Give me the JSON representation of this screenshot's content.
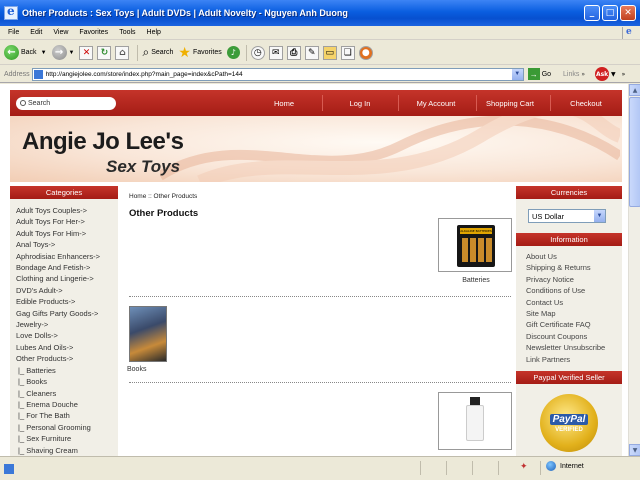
{
  "window": {
    "title": "Other Products : Sex Toys | Adult DVDs | Adult Novelty - Nguyen Anh Duong"
  },
  "menu": [
    "File",
    "Edit",
    "View",
    "Favorites",
    "Tools",
    "Help"
  ],
  "toolbar": {
    "back_label": "Back",
    "search_label": "Search",
    "favorites_label": "Favorites"
  },
  "address": {
    "label": "Address",
    "url": "http://angiejolee.com/store/index.php?main_page=index&cPath=144",
    "go_label": "Go",
    "links_label": "Links"
  },
  "site": {
    "search_placeholder": "Search",
    "nav": [
      "Home",
      "Log In",
      "My Account",
      "Shopping Cart",
      "Checkout"
    ],
    "logo_main": "Angie Jo Lee's",
    "logo_sub": "Sex Toys",
    "categories_title": "Categories",
    "categories": [
      "Adult Toys Couples->",
      "Adult Toys For Her->",
      "Adult Toys For Him->",
      "Anal Toys->",
      "Aphrodisiac Enhancers->",
      "Bondage And Fetish->",
      "Clothing and Lingerie->",
      "DVD's Adult->",
      "Edible Products->",
      "Gag Gifts Party Goods->",
      "Jewelry->",
      "Love Dolls->",
      "Lubes And Oils->",
      "Other Products->"
    ],
    "subcategories": [
      "|_ Batteries",
      "|_ Books",
      "|_ Cleaners",
      "|_ Enema Douche",
      "|_ For The Bath",
      "|_ Personal Grooming",
      "|_ Sex Furniture",
      "|_ Shaving Cream"
    ],
    "breadcrumb": "Home :: Other Products",
    "page_title": "Other Products",
    "products": [
      "Batteries",
      "Books"
    ],
    "battery_pack_text": "ALKALINE BATTERIES",
    "currencies_title": "Currencies",
    "currency_selected": "US Dollar",
    "information_title": "Information",
    "information": [
      "About Us",
      "Shipping & Returns",
      "Privacy Notice",
      "Conditions of Use",
      "Contact Us",
      "Site Map",
      "Gift Certificate FAQ",
      "Discount Coupons",
      "Newsletter Unsubscribe",
      "Link Partners"
    ],
    "paypal_title": "Paypal Verified Seller",
    "paypal_badge_text": "PayPal",
    "paypal_badge_sub": "VERIFIED"
  },
  "status": {
    "zone_label": "Internet"
  },
  "colors": {
    "accent_red": "#b2241b",
    "sidebar_bg": "#f1efe7",
    "xp_blue": "#0a5ee0"
  }
}
